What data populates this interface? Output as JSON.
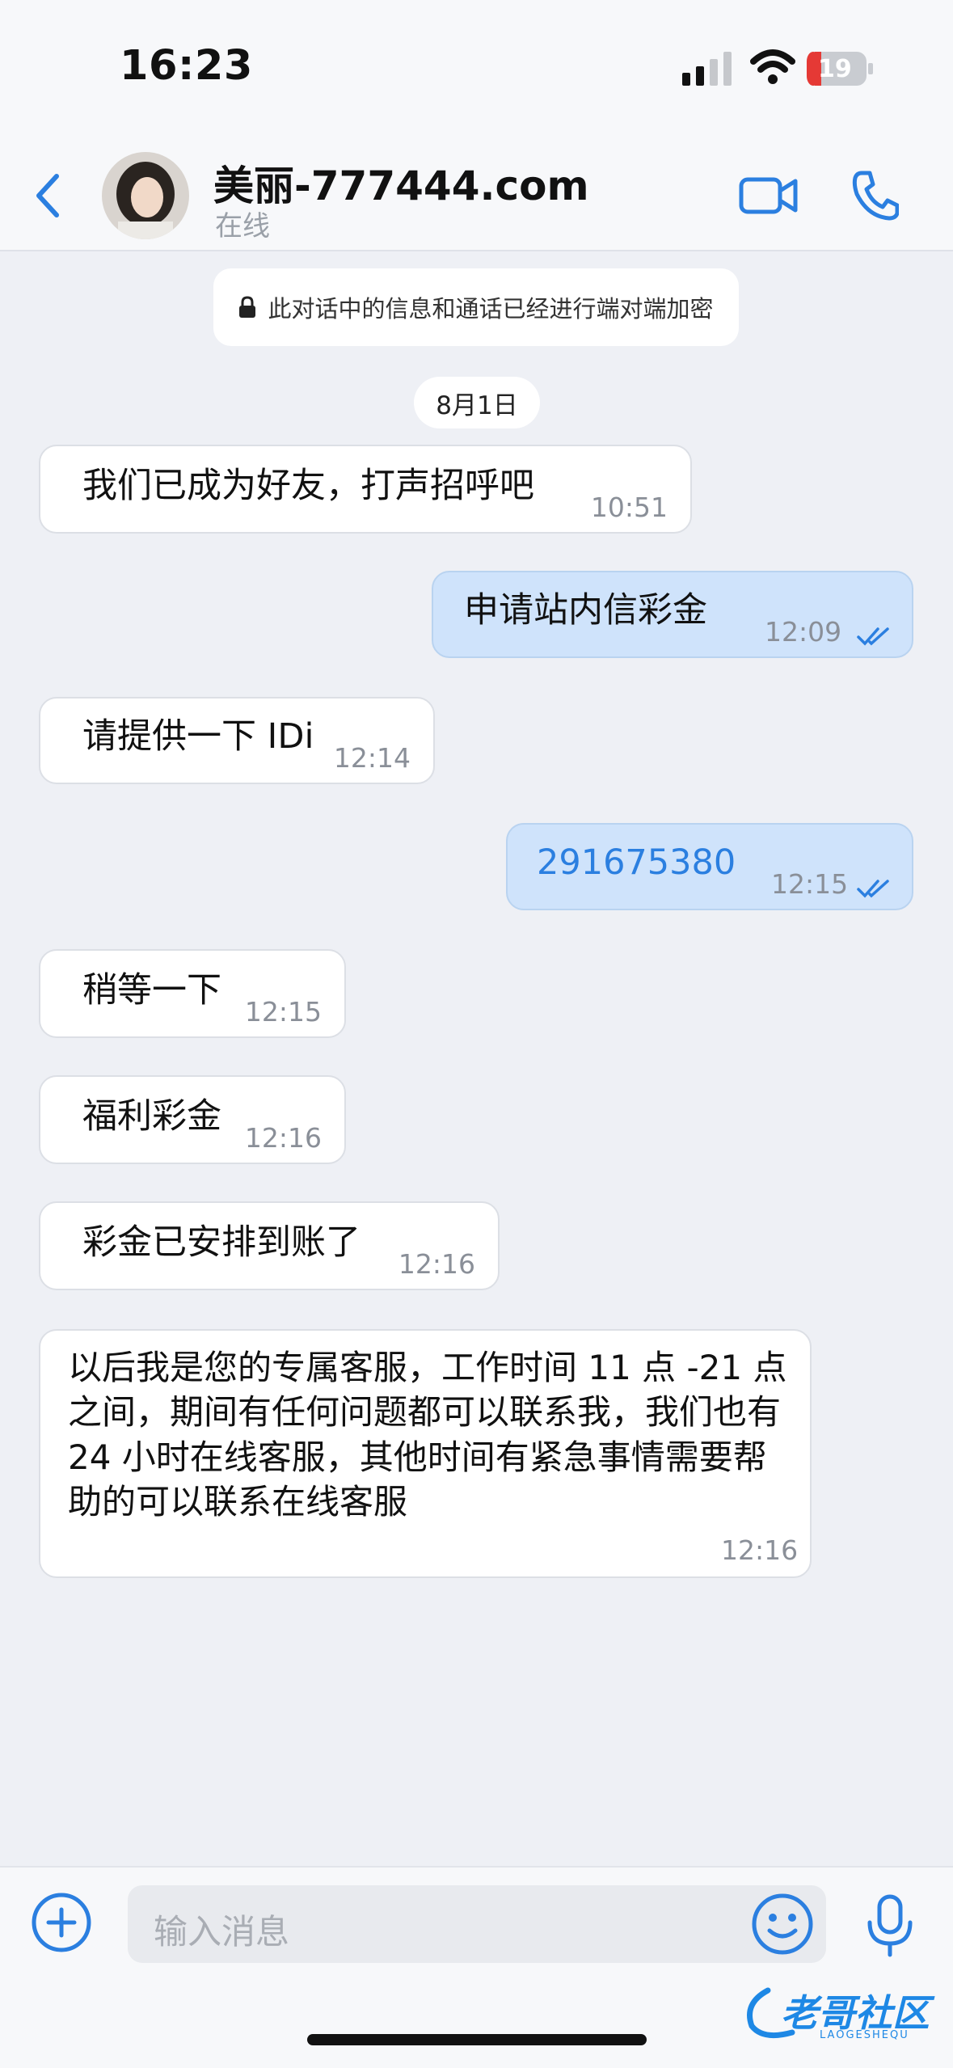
{
  "status_bar": {
    "time": "16:23",
    "battery": "19"
  },
  "header": {
    "contact_name": "美丽-777444.com",
    "status": "在线"
  },
  "notice": {
    "encryption": "此对话中的信息和通话已经进行端对端加密"
  },
  "date_divider": "8月1日",
  "messages": [
    {
      "dir": "in",
      "text": "我们已成为好友，打声招呼吧",
      "time": "10:51"
    },
    {
      "dir": "out",
      "text": "申请站内信彩金",
      "time": "12:09"
    },
    {
      "dir": "in",
      "text": "请提供一下 IDi",
      "time": "12:14"
    },
    {
      "dir": "out",
      "text": "291675380",
      "time": "12:15"
    },
    {
      "dir": "in",
      "text": "稍等一下",
      "time": "12:15"
    },
    {
      "dir": "in",
      "text": "福利彩金",
      "time": "12:16"
    },
    {
      "dir": "in",
      "text": "彩金已安排到账了",
      "time": "12:16"
    },
    {
      "dir": "in",
      "text": "以后我是您的专属客服，工作时间 11 点 -21 点之间，期间有任何问题都可以联系我，我们也有 24 小时在线客服，其他时间有紧急事情需要帮助的可以联系在线客服",
      "time": "12:16"
    }
  ],
  "composer": {
    "placeholder": "输入消息"
  },
  "watermark": {
    "text": "老哥社区",
    "subtext": "LAOGESHEQU"
  },
  "colors": {
    "accent": "#2b7fe0",
    "outgoing_bubble": "#cfe3fb",
    "incoming_bubble": "#ffffff",
    "chat_background": "#eef0f5"
  },
  "icons": [
    "back-chevron-icon",
    "video-call-icon",
    "phone-call-icon",
    "lock-icon",
    "read-check-icon",
    "plus-icon",
    "emoji-icon",
    "microphone-icon"
  ]
}
